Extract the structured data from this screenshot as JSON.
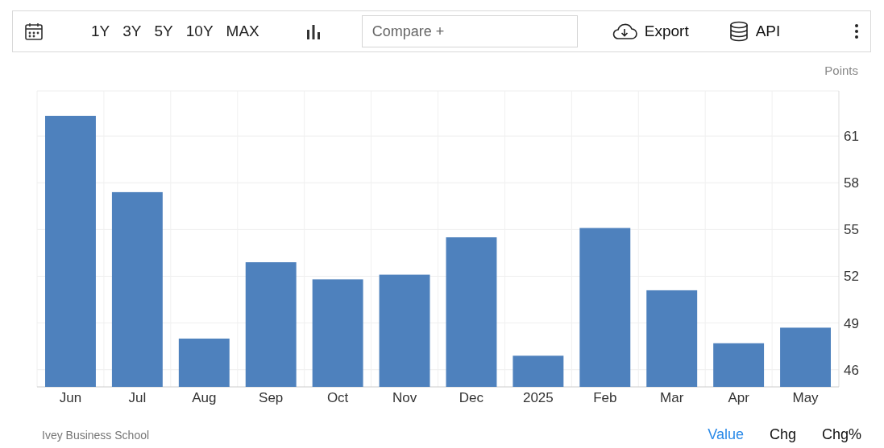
{
  "toolbar": {
    "ranges": [
      {
        "label": "1Y",
        "selected": false
      },
      {
        "label": "3Y",
        "selected": false
      },
      {
        "label": "5Y",
        "selected": false
      },
      {
        "label": "10Y",
        "selected": false
      },
      {
        "label": "MAX",
        "selected": false
      }
    ],
    "compare": {
      "placeholder": "Compare +"
    },
    "export": "Export",
    "api": "API"
  },
  "chart": {
    "unit": "Points",
    "chart_data": {
      "type": "bar",
      "categories": [
        "Jun",
        "Jul",
        "Aug",
        "Sep",
        "Oct",
        "Nov",
        "Dec",
        "2025",
        "Feb",
        "Mar",
        "Apr",
        "May"
      ],
      "grid": true,
      "series": [
        {
          "color": "#4e81bd",
          "values": [
            62.3,
            57.4,
            48.0,
            52.9,
            51.8,
            52.1,
            54.5,
            46.9,
            55.1,
            51.1,
            47.7,
            48.7
          ]
        }
      ],
      "ylim": [
        44.9,
        63.9
      ],
      "yticks": [
        46,
        49,
        52,
        55,
        58,
        61
      ]
    }
  },
  "footer": {
    "source": "Ivey Business School",
    "views": [
      {
        "label": "Value",
        "selected": true
      },
      {
        "label": "Chg",
        "selected": false
      },
      {
        "label": "Chg%",
        "selected": false
      }
    ]
  }
}
